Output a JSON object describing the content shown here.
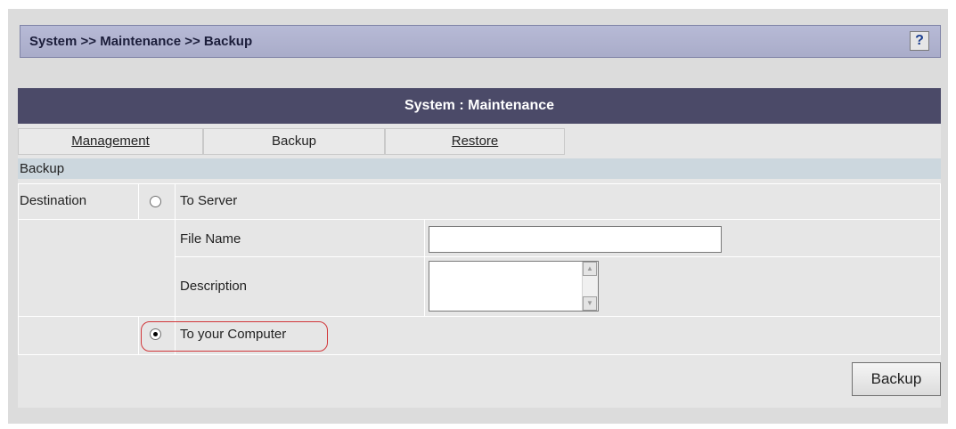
{
  "header": {
    "breadcrumb": "System >> Maintenance >> Backup",
    "help_label": "?"
  },
  "panel": {
    "title": "System : Maintenance"
  },
  "tabs": [
    {
      "label": "Management",
      "link": true
    },
    {
      "label": "Backup",
      "link": false
    },
    {
      "label": "Restore",
      "link": true
    }
  ],
  "backup": {
    "section_label": "Backup",
    "destination_label": "Destination",
    "to_server_label": "To Server",
    "to_server_selected": false,
    "file_name_label": "File Name",
    "file_name_value": "",
    "description_label": "Description",
    "description_value": "",
    "to_computer_label": "To your Computer",
    "to_computer_selected": true,
    "button_label": "Backup"
  },
  "colors": {
    "title_bar": "#4b4a68",
    "header_bar": "#b0b3cf",
    "highlight": "#d1373a"
  }
}
